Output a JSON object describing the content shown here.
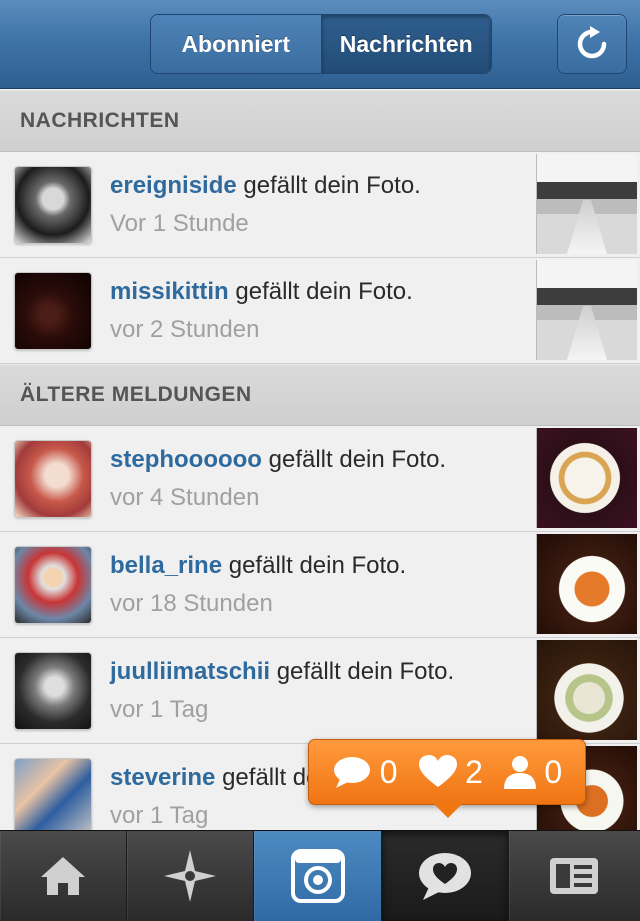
{
  "header": {
    "tabs": [
      {
        "label": "Abonniert",
        "active": false
      },
      {
        "label": "Nachrichten",
        "active": true
      }
    ],
    "refresh_icon": "refresh-icon"
  },
  "sections": [
    {
      "title": "NACHRICHTEN"
    },
    {
      "title": "ÄLTERE MELDUNGEN"
    }
  ],
  "rows": [
    {
      "username": "ereigniside",
      "action": " gefällt dein Foto.",
      "time": "Vor 1 Stunde"
    },
    {
      "username": "missikittin",
      "action": " gefällt dein Foto.",
      "time": "vor 2 Stunden"
    },
    {
      "username": "stephoooooo",
      "action": " gefällt dein Foto.",
      "time": "vor 4 Stunden"
    },
    {
      "username": "bella_rine",
      "action": " gefällt dein Foto.",
      "time": "vor 18 Stunden"
    },
    {
      "username": "juulliimatschii",
      "action": " gefällt dein Foto.",
      "time": "vor 1 Tag"
    },
    {
      "username": "steverine",
      "action": " gefällt dein Foto.",
      "time": "vor 1 Tag"
    }
  ],
  "notification": {
    "comments": "0",
    "likes": "2",
    "followers": "0"
  },
  "tabbar": [
    "home-icon",
    "explore-icon",
    "camera-icon",
    "news-icon",
    "profile-icon"
  ],
  "colors": {
    "accent": "#3f74a8",
    "username": "#2f6a9e",
    "popup": "#f07513"
  }
}
